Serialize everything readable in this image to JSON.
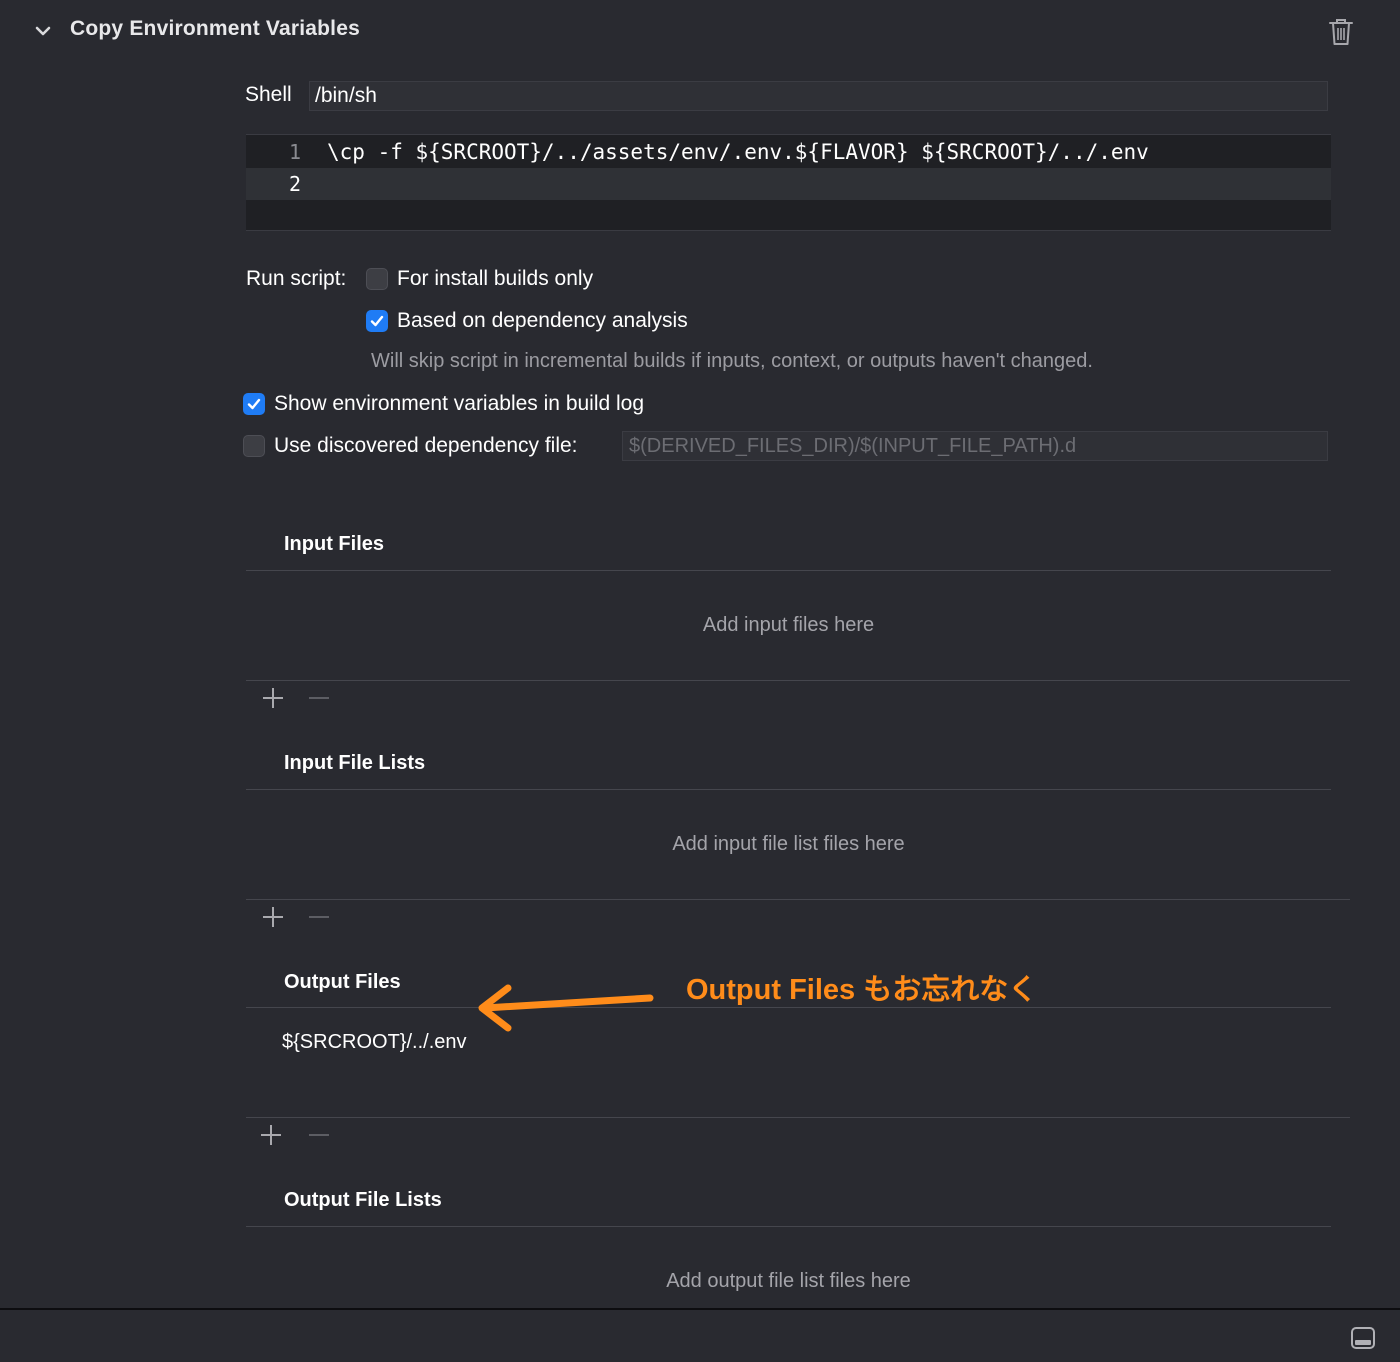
{
  "header": {
    "title": "Copy Environment Variables",
    "collapse_icon": "chevron-down-icon",
    "delete_icon": "trash-icon"
  },
  "shell": {
    "label": "Shell",
    "value": "/bin/sh"
  },
  "script": {
    "lines": [
      {
        "number": "1",
        "text": "\\cp -f ${SRCROOT}/../assets/env/.env.${FLAVOR} ${SRCROOT}/../.env"
      },
      {
        "number": "2",
        "text": ""
      }
    ]
  },
  "run_script": {
    "label": "Run script:",
    "install_builds_only": {
      "label": "For install builds only",
      "checked": false
    },
    "dependency_analysis": {
      "label": "Based on dependency analysis",
      "checked": true
    },
    "dependency_hint": "Will skip script in incremental builds if inputs, context, or outputs haven't changed."
  },
  "show_env_vars": {
    "label": "Show environment variables in build log",
    "checked": true
  },
  "discovered_dep_file": {
    "label": "Use discovered dependency file:",
    "checked": false,
    "placeholder": "$(DERIVED_FILES_DIR)/$(INPUT_FILE_PATH).d"
  },
  "sections": {
    "input_files": {
      "title": "Input Files",
      "placeholder": "Add input files here"
    },
    "input_file_lists": {
      "title": "Input File Lists",
      "placeholder": "Add input file list files here"
    },
    "output_files": {
      "title": "Output Files",
      "entries": [
        "${SRCROOT}/../.env"
      ]
    },
    "output_file_lists": {
      "title": "Output File Lists",
      "placeholder": "Add output file list files here"
    }
  },
  "annotation": {
    "text": "Output Files もお忘れなく",
    "color": "#ff8c1a"
  },
  "colors": {
    "background": "#292a30",
    "checkbox_on": "#1f7cf5",
    "accent_annotation": "#ff8c1a"
  }
}
